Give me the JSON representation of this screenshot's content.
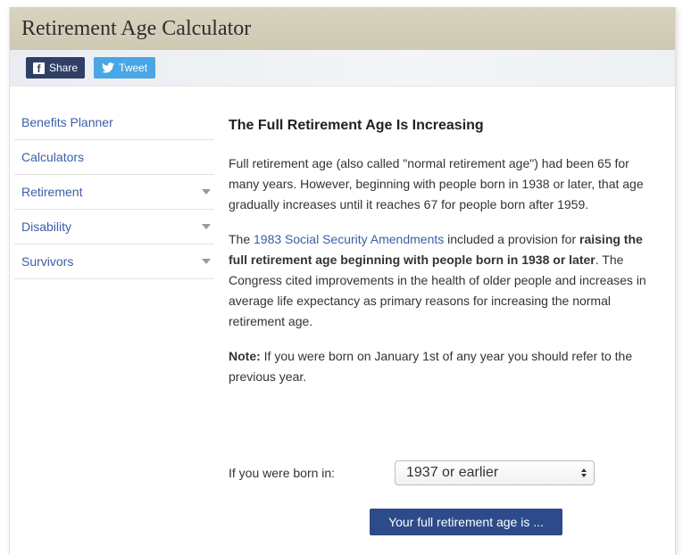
{
  "header": {
    "title": "Retirement Age Calculator"
  },
  "social": {
    "share_label": "Share",
    "tweet_label": "Tweet"
  },
  "sidebar": {
    "items": [
      {
        "label": "Benefits Planner",
        "has_caret": false
      },
      {
        "label": "Calculators",
        "has_caret": false
      },
      {
        "label": "Retirement",
        "has_caret": true
      },
      {
        "label": "Disability",
        "has_caret": true
      },
      {
        "label": "Survivors",
        "has_caret": true
      }
    ]
  },
  "main": {
    "heading": "The Full Retirement Age Is Increasing",
    "para1": "Full retirement age (also called \"normal retirement age\") had been 65 for many years. However, beginning with people born in 1938 or later, that age gradually increases until it reaches 67 for people born after 1959.",
    "para2_prefix": "The ",
    "para2_link": "1983 Social Security Amendments",
    "para2_mid": " included a provision for ",
    "para2_bold": "raising the full retirement age beginning with people born in 1938 or later",
    "para2_suffix": ". The Congress cited improvements in the health of older people and increases in average life expectancy as primary reasons for increasing the normal retirement age.",
    "note_label": "Note:",
    "note_text": " If you were born on January 1st of any year you should refer to the previous year."
  },
  "form": {
    "born_label": "If you were born in:",
    "born_selected": "1937 or earlier",
    "result_button": "Your full retirement age is ..."
  },
  "colors": {
    "link": "#3a5ea8",
    "title_bar": "#d3cdb8",
    "share_button": "#2f3f66",
    "tweet_button": "#4aa6e4",
    "result_button": "#2d4a8a"
  }
}
